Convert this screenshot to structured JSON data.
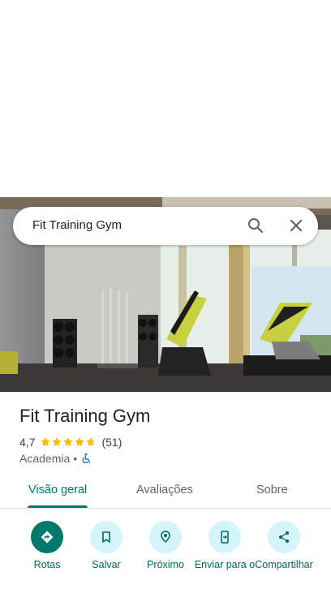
{
  "search": {
    "query": "Fit Training Gym"
  },
  "place": {
    "title": "Fit Training Gym",
    "rating": "4,7",
    "rating_value": 4.7,
    "review_count": "(51)",
    "category": "Academia",
    "separator": "•"
  },
  "tabs": [
    {
      "label": "Visão geral",
      "active": true
    },
    {
      "label": "Avaliações",
      "active": false
    },
    {
      "label": "Sobre",
      "active": false
    }
  ],
  "actions": [
    {
      "label": "Rotas",
      "icon": "directions-icon"
    },
    {
      "label": "Salvar",
      "icon": "bookmark-icon"
    },
    {
      "label": "Próximo",
      "icon": "nearby-icon"
    },
    {
      "label": "Enviar para o",
      "icon": "send-to-phone-icon"
    },
    {
      "label": "Compartilhar",
      "icon": "share-icon"
    }
  ],
  "colors": {
    "accent": "#00796b",
    "action_bg": "#d3f5fb",
    "star": "#fbbc04",
    "access_icon": "#1a73e8"
  }
}
